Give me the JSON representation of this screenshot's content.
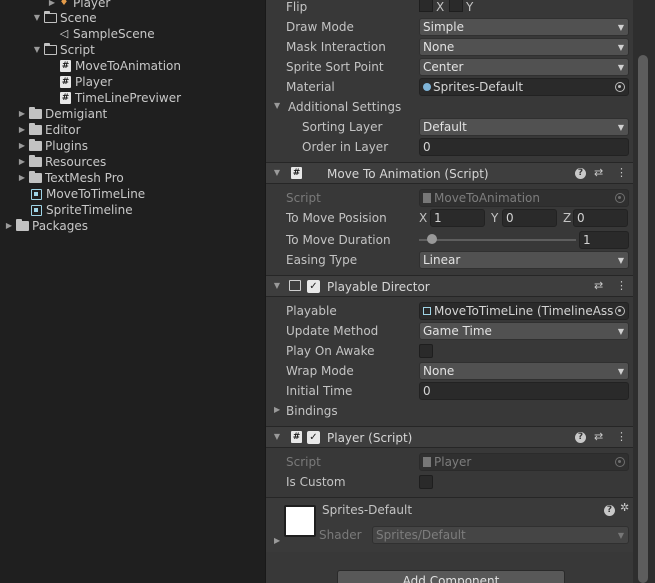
{
  "project": {
    "items": [
      {
        "label": "Player",
        "icon": "player-icon",
        "tri": "▶"
      },
      {
        "label": "Scene",
        "icon": "folder-open-icon",
        "tri": "▼"
      },
      {
        "label": "SampleScene",
        "icon": "unity-scene-icon",
        "tri": ""
      },
      {
        "label": "Script",
        "icon": "folder-open-icon",
        "tri": "▼"
      },
      {
        "label": "MoveToAnimation",
        "icon": "csharp-script-icon",
        "tri": ""
      },
      {
        "label": "Player",
        "icon": "csharp-script-icon",
        "tri": ""
      },
      {
        "label": "TimeLinePreviwer",
        "icon": "csharp-script-icon",
        "tri": ""
      },
      {
        "label": "Demigiant",
        "icon": "folder-icon",
        "tri": "▶"
      },
      {
        "label": "Editor",
        "icon": "folder-icon",
        "tri": "▶"
      },
      {
        "label": "Plugins",
        "icon": "folder-icon",
        "tri": "▶"
      },
      {
        "label": "Resources",
        "icon": "folder-icon",
        "tri": "▶"
      },
      {
        "label": "TextMesh Pro",
        "icon": "folder-icon",
        "tri": "▶"
      },
      {
        "label": "MoveToTimeLine",
        "icon": "timeline-asset-icon",
        "tri": ""
      },
      {
        "label": "SpriteTimeline",
        "icon": "timeline-asset-icon",
        "tri": ""
      },
      {
        "label": "Packages",
        "icon": "folder-icon",
        "tri": "▶"
      }
    ]
  },
  "sprite_renderer": {
    "flip_label": "Flip",
    "flip_x": "X",
    "flip_y": "Y",
    "draw_mode_label": "Draw Mode",
    "draw_mode_value": "Simple",
    "mask_label": "Mask Interaction",
    "mask_value": "None",
    "sort_point_label": "Sprite Sort Point",
    "sort_point_value": "Center",
    "material_label": "Material",
    "material_value": "Sprites-Default",
    "additional_label": "Additional Settings",
    "sorting_layer_label": "Sorting Layer",
    "sorting_layer_value": "Default",
    "order_label": "Order in Layer",
    "order_value": "0"
  },
  "move_to_animation": {
    "title": "Move To Animation (Script)",
    "script_label": "Script",
    "script_value": "MoveToAnimation",
    "posision_label": "To Move Posision",
    "x_label": "X",
    "x_value": "1",
    "y_label": "Y",
    "y_value": "0",
    "z_label": "Z",
    "z_value": "0",
    "duration_label": "To Move Duration",
    "duration_value": "1",
    "duration_slider_fraction": 0.08,
    "easing_label": "Easing Type",
    "easing_value": "Linear"
  },
  "playable_director": {
    "title": "Playable Director",
    "playable_label": "Playable",
    "playable_value": "MoveToTimeLine (TimelineAss",
    "update_label": "Update Method",
    "update_value": "Game Time",
    "play_on_awake_label": "Play On Awake",
    "wrap_label": "Wrap Mode",
    "wrap_value": "None",
    "initial_time_label": "Initial Time",
    "initial_time_value": "0",
    "bindings_label": "Bindings"
  },
  "player_script": {
    "title": "Player (Script)",
    "script_label": "Script",
    "script_value": "Player",
    "is_custom_label": "Is Custom"
  },
  "material": {
    "name": "Sprites-Default",
    "shader_label": "Shader",
    "shader_value": "Sprites/Default"
  },
  "add_component_label": "Add Component",
  "glyphs": {
    "help": "?",
    "presets": "⇄",
    "menu": "⋮",
    "check": "✓",
    "gear": "✲",
    "dropdown": "▼",
    "collapse": "▼",
    "expand": "▶"
  }
}
